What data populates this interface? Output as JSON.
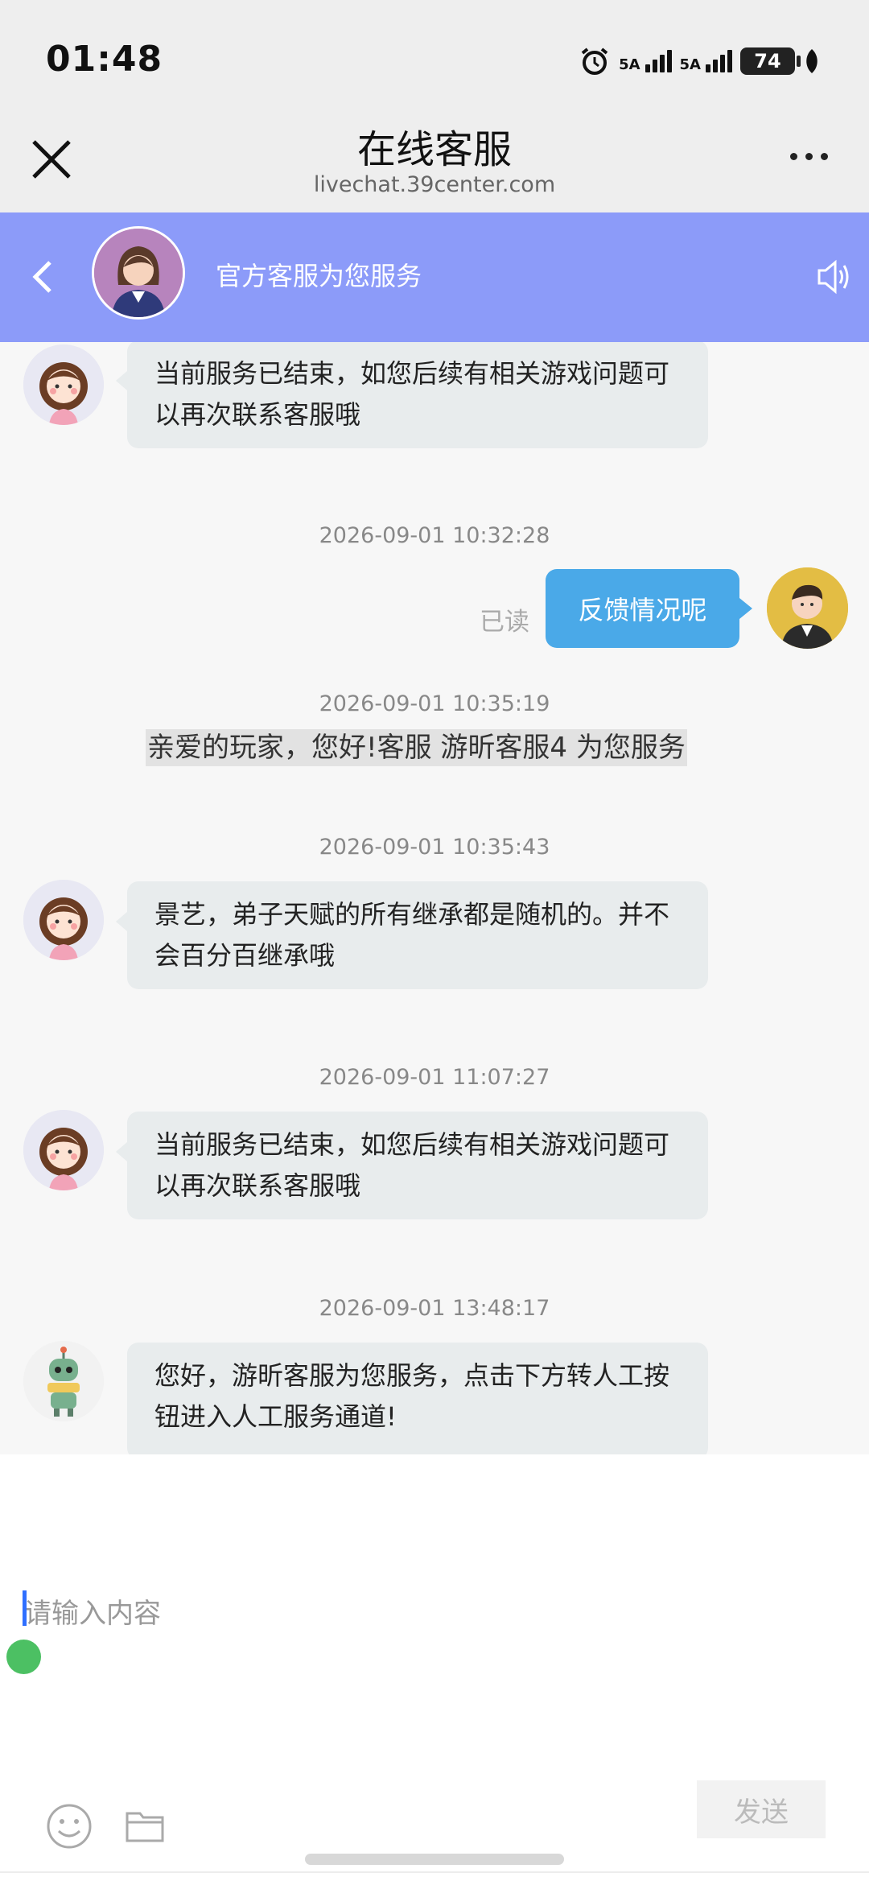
{
  "status_bar": {
    "time": "01:48",
    "signal1": "5A",
    "signal2": "5A",
    "battery": "74"
  },
  "titlebar": {
    "title": "在线客服",
    "url": "livechat.39center.com"
  },
  "chat_header": {
    "label": "官方客服为您服务"
  },
  "messages": {
    "m1_text": "当前服务已结束，如您后续有相关游戏问题可以再次联系客服哦",
    "ts1": "2026-09-01 10:32:28",
    "user_text": "反馈情况呢",
    "read_label": "已读",
    "ts2": "2026-09-01 10:35:19",
    "sys_text": "亲爱的玩家，您好!客服 游昕客服4 为您服务",
    "ts3": "2026-09-01 10:35:43",
    "m2_text": "景艺，弟子天赋的所有继承都是随机的。并不会百分百继承哦",
    "ts4": "2026-09-01 11:07:27",
    "m3_text": "当前服务已结束，如您后续有相关游戏问题可以再次联系客服哦",
    "ts5": "2026-09-01 13:48:17",
    "m4_text": "您好，游昕客服为您服务，点击下方转人工按钮进入人工服务通道!"
  },
  "input": {
    "placeholder": "请输入内容",
    "send_label": "发送"
  },
  "colors": {
    "header_bg": "#8c9bf9",
    "user_bubble": "#4aa9e8",
    "agent_bubble": "#e8eced",
    "status_dot": "#4cc063"
  },
  "icons": [
    "close-icon",
    "more-icon",
    "back-icon",
    "speaker-icon",
    "alarm-icon",
    "battery-icon",
    "emoji-icon",
    "folder-icon"
  ]
}
